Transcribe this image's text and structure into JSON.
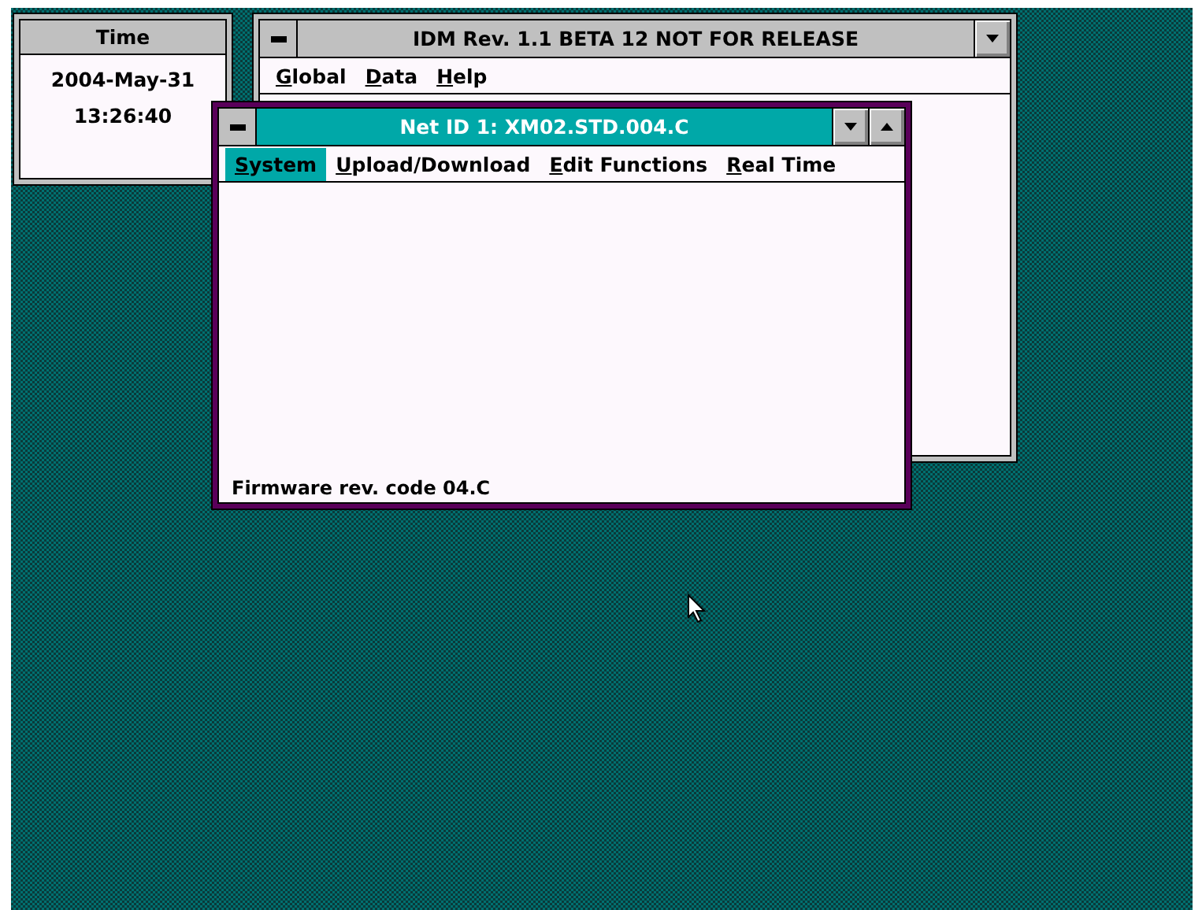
{
  "time_window": {
    "title": "Time",
    "date": "2004-May-31",
    "time": "13:26:40"
  },
  "main_window": {
    "title": "IDM Rev. 1.1 BETA 12 NOT FOR RELEASE",
    "active": false,
    "buttons": [
      {
        "kind": "minimize"
      }
    ],
    "menu": [
      {
        "label": "Global",
        "selected": false
      },
      {
        "label": "Data",
        "selected": false
      },
      {
        "label": "Help",
        "selected": false
      }
    ]
  },
  "child_window": {
    "title": "Net ID 1: XM02.STD.004.C",
    "active": true,
    "buttons": [
      {
        "kind": "minimize"
      },
      {
        "kind": "maximize"
      }
    ],
    "menu": [
      {
        "label": "System",
        "selected": true
      },
      {
        "label": "Upload/Download",
        "selected": false
      },
      {
        "label": "Edit Functions",
        "selected": false
      },
      {
        "label": "Real Time",
        "selected": false
      }
    ],
    "status": "Firmware rev. code 04.C"
  }
}
